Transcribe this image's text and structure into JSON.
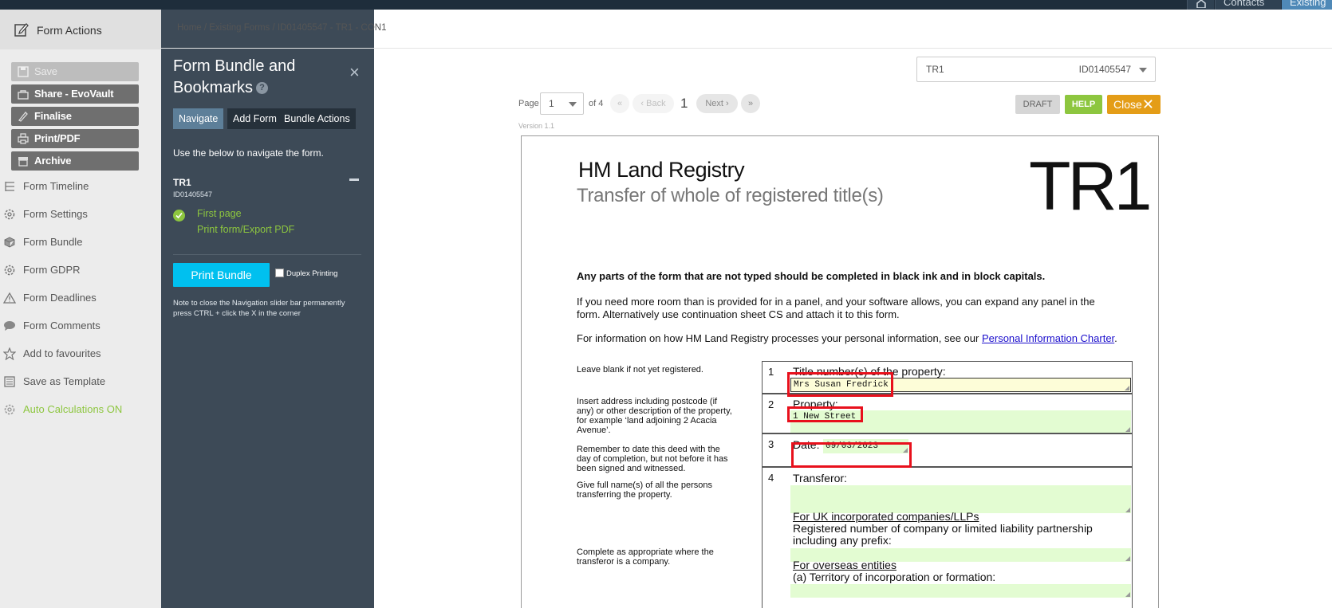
{
  "topbar": {
    "contacts_label": "Contacts",
    "existing_label": "Existing"
  },
  "left": {
    "header": "Form Actions",
    "buttons": [
      {
        "label": "Save",
        "icon": "save-icon",
        "disabled": true
      },
      {
        "label": "Share - EvoVault",
        "icon": "share-icon"
      },
      {
        "label": "Finalise",
        "icon": "finalise-icon"
      },
      {
        "label": "Print/PDF",
        "icon": "print-icon"
      },
      {
        "label": "Archive",
        "icon": "archive-icon"
      }
    ],
    "links": [
      {
        "label": "Form Timeline",
        "icon": "timeline-icon"
      },
      {
        "label": "Form Settings",
        "icon": "gear-icon"
      },
      {
        "label": "Form Bundle",
        "icon": "bundle-icon"
      },
      {
        "label": "Form GDPR",
        "icon": "gear-icon"
      },
      {
        "label": "Form Deadlines",
        "icon": "warning-icon"
      },
      {
        "label": "Form Comments",
        "icon": "comment-icon"
      },
      {
        "label": "Add to favourites",
        "icon": "star-icon"
      },
      {
        "label": "Save as Template",
        "icon": "template-icon"
      },
      {
        "label": "Auto Calculations ON",
        "icon": "gear-icon"
      }
    ]
  },
  "breadcrumb": "Home / Existing Forms / ID01405547 - TR1 - CON1",
  "bookmarks": {
    "title": "Form Bundle and Bookmarks",
    "help": "?",
    "close": "×",
    "tabs": [
      "Navigate",
      "Add Form",
      "Bundle Actions"
    ],
    "hint": "Use the below to navigate the form.",
    "form_name": "TR1",
    "form_id": "ID01405547",
    "items": [
      "First page",
      "Print form/Export PDF"
    ],
    "print_bundle": "Print Bundle",
    "duplex": "Duplex Printing",
    "note": "Note to close the Navigation slider bar permanently press CTRL + click the X in the corner"
  },
  "form_select": {
    "name": "TR1",
    "id": "ID01405547"
  },
  "pager": {
    "page_label": "Page",
    "page": "1",
    "of": "of 4",
    "first": "«",
    "back": "‹ Back",
    "current": "1",
    "next": "Next ›",
    "last": "»",
    "version": "Version 1.1"
  },
  "actions": {
    "draft": "DRAFT",
    "help": "HELP",
    "close": "Close"
  },
  "document": {
    "org": "HM Land Registry",
    "subtitle": "Transfer of whole of registered title(s)",
    "code": "TR1",
    "intro_bold": "Any parts of the form that are not typed should be completed in black ink and in block capitals.",
    "intro_2": "If you need more room than is provided for in a panel, and your software allows, you can expand any panel in the form. Alternatively use continuation sheet CS and attach it to this form.",
    "intro_3_text": "For information on how HM Land Registry processes your personal information, see our ",
    "intro_3_link": "Personal Information Charter",
    "intro_3_end": ".",
    "notes": [
      "Leave blank if not yet registered.",
      "Insert address including postcode (if any) or other description of the property, for example ‘land adjoining 2 Acacia Avenue’.",
      "Remember to date this deed with the day of completion, but not before it has been signed and witnessed.",
      "Give full name(s) of all the persons transferring the property.",
      "Complete as appropriate where the transferor is a company."
    ],
    "panels": [
      {
        "num": "1",
        "label": "Title number(s) of the property:",
        "value": "Mrs Susan Fredrick"
      },
      {
        "num": "2",
        "label": "Property:",
        "value": "1 New Street"
      },
      {
        "num": "3",
        "label": "Date:",
        "value": "09/03/2023"
      },
      {
        "num": "4",
        "label": "Transferor:",
        "value": ""
      }
    ],
    "uk_companies": "For UK incorporated companies/LLPs",
    "reg_number": "Registered number of company or limited liability partnership including any prefix:",
    "overseas": "For overseas entities",
    "territory": "(a) Territory of incorporation or formation:"
  },
  "colors": {
    "accent_cyan": "#00c0ef",
    "green": "#8dc63f",
    "orange": "#e49d17",
    "panel_bg": "#3d4a57",
    "highlight_red": "#e8101c"
  }
}
